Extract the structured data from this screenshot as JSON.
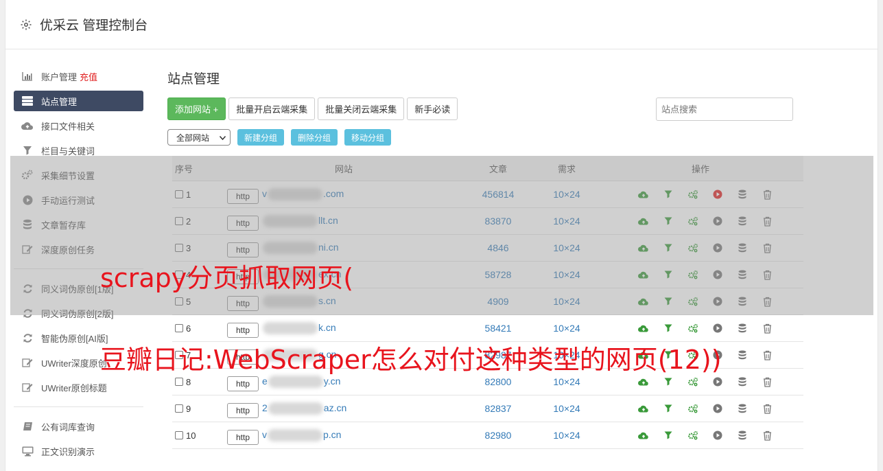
{
  "header": {
    "title": "优采云 管理控制台"
  },
  "sidebar": {
    "items": [
      {
        "label": "账户管理",
        "extra": "充值",
        "icon": "bar-chart-icon"
      },
      {
        "label": "站点管理",
        "icon": "server-icon",
        "active": true
      },
      {
        "label": "接口文件相关",
        "icon": "cloud-upload-icon"
      },
      {
        "label": "栏目与关键词",
        "icon": "filter-icon"
      },
      {
        "label": "采集细节设置",
        "icon": "gears-icon"
      },
      {
        "label": "手动运行测试",
        "icon": "play-circle-icon"
      },
      {
        "label": "文章暂存库",
        "icon": "database-icon"
      },
      {
        "label": "深度原创任务",
        "icon": "edit-icon"
      }
    ],
    "group2": [
      {
        "label": "同义词伪原创[1版]",
        "icon": "refresh-icon"
      },
      {
        "label": "同义词伪原创[2版]",
        "icon": "refresh-icon"
      },
      {
        "label": "智能伪原创[AI版]",
        "icon": "refresh-icon"
      },
      {
        "label": "UWriter深度原创",
        "icon": "edit-icon"
      },
      {
        "label": "UWriter原创标题",
        "icon": "edit-icon"
      }
    ],
    "group3": [
      {
        "label": "公有词库查询",
        "icon": "book-icon"
      },
      {
        "label": "正文识别演示",
        "icon": "monitor-icon"
      }
    ]
  },
  "main": {
    "title": "站点管理",
    "buttons": {
      "add": "添加网站 +",
      "open_all": "批量开启云端采集",
      "close_all": "批量关闭云端采集",
      "guide": "新手必读"
    },
    "search_placeholder": "站点搜索",
    "group_select": "全部网站",
    "group_buttons": {
      "new": "新建分组",
      "delete": "删除分组",
      "move": "移动分组"
    },
    "table": {
      "headers": {
        "index": "序号",
        "site": "网站",
        "articles": "文章",
        "demand": "需求",
        "actions": "操作"
      },
      "http_label": "http",
      "rows": [
        {
          "index": "1",
          "prefix": "v",
          "suffix": ".com",
          "articles": "456814",
          "demand": "10×24",
          "running": true
        },
        {
          "index": "2",
          "prefix": "",
          "suffix": "llt.cn",
          "articles": "83870",
          "demand": "10×24"
        },
        {
          "index": "3",
          "prefix": "",
          "suffix": "ni.cn",
          "articles": "4846",
          "demand": "10×24"
        },
        {
          "index": "4",
          "prefix": "",
          "suffix": "ex.cn",
          "articles": "58728",
          "demand": "10×24"
        },
        {
          "index": "5",
          "prefix": "",
          "suffix": "s.cn",
          "articles": "4909",
          "demand": "10×24"
        },
        {
          "index": "6",
          "prefix": "",
          "suffix": "k.cn",
          "articles": "58421",
          "demand": "10×24"
        },
        {
          "index": "7",
          "prefix": "",
          "suffix": "g.cn",
          "articles": "82987",
          "demand": "10×24"
        },
        {
          "index": "8",
          "prefix": "e",
          "suffix": "y.cn",
          "articles": "82800",
          "demand": "10×24"
        },
        {
          "index": "9",
          "prefix": "2",
          "suffix": "az.cn",
          "articles": "82837",
          "demand": "10×24"
        },
        {
          "index": "10",
          "prefix": "v",
          "suffix": "p.cn",
          "articles": "82980",
          "demand": "10×24"
        }
      ]
    }
  },
  "watermark": {
    "line1": "scrapy分页抓取网页(",
    "line2": "豆瓣日记:WebScraper怎么对付这种类型的网页(12))"
  },
  "colors": {
    "accent_green": "#5cb85c",
    "info_blue": "#5bc0de",
    "sidebar_active": "#3e4a63",
    "watermark_red": "#e8141d"
  }
}
